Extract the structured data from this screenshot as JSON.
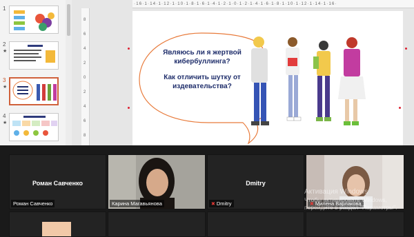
{
  "thumbnails": [
    {
      "number": "1",
      "star": "",
      "active": false
    },
    {
      "number": "2",
      "star": "★",
      "active": false
    },
    {
      "number": "3",
      "star": "★",
      "active": true
    },
    {
      "number": "4",
      "star": "★",
      "active": false
    }
  ],
  "ruler": {
    "top": "·16·1·14·1·12·1·10·1·8·1·6·1·4·1·2·1·0·1·2·1·4·1·6·1·8·1·10·1·12·1·14·1·16·",
    "left": [
      "8",
      "6",
      "4",
      "2",
      "0",
      "2",
      "4",
      "6",
      "8"
    ]
  },
  "slide": {
    "question1": "Являюсь ли я жертвой кибербуллинга?",
    "question2": "Как отличить шутку от издевательства?",
    "accent_color": "#e87a3a",
    "text_color": "#1f2e6b"
  },
  "participants": [
    {
      "name": "Роман Савченко",
      "center_name": "Роман Савченко",
      "muted": false,
      "video": false
    },
    {
      "name": "Карина Магавьянова",
      "center_name": "",
      "muted": false,
      "video": true
    },
    {
      "name": "Dmitry",
      "center_name": "Dmitry",
      "muted": true,
      "video": false
    },
    {
      "name": "Милена Варлакова",
      "center_name": "",
      "muted": true,
      "video": true
    }
  ],
  "watermark": {
    "title": "Активация Windows",
    "line1": "Чтобы активировать Windows,",
    "line2": "перейдите в раздел \"Параметры\"."
  }
}
